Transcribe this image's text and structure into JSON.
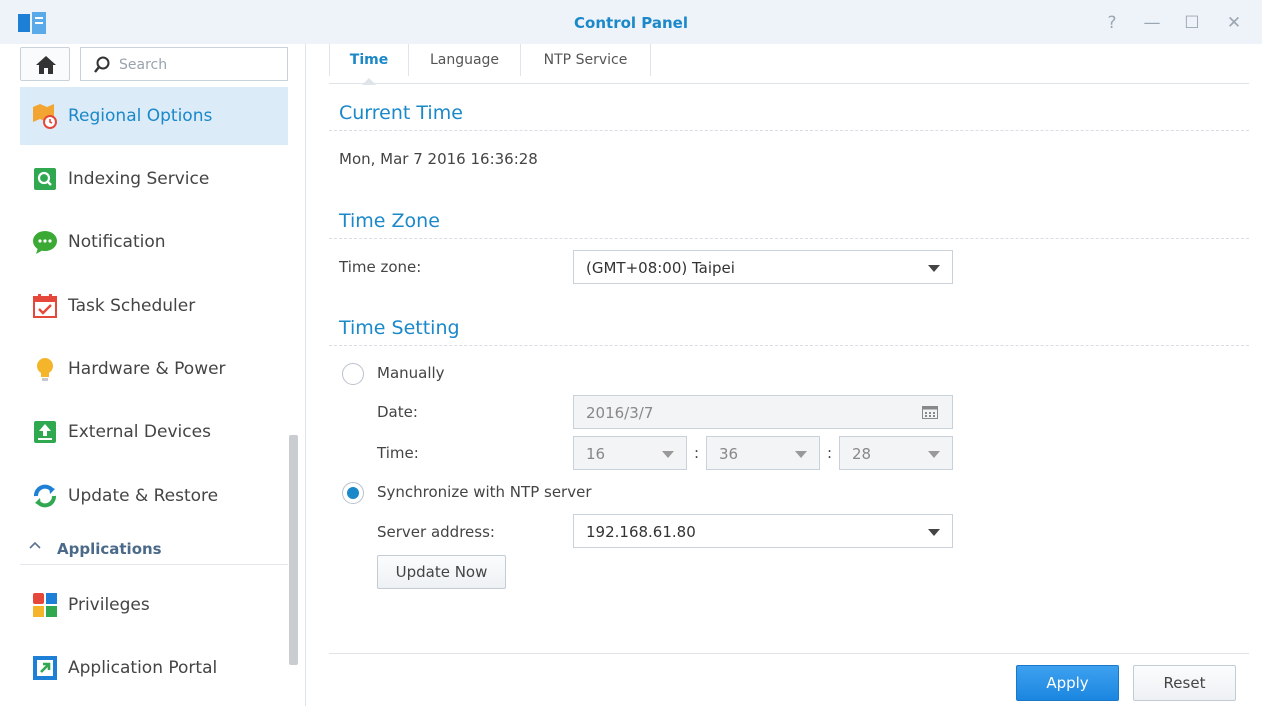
{
  "window": {
    "title": "Control Panel",
    "controls": {
      "help": "?",
      "minimize": "—",
      "maximize": "☐",
      "close": "✕"
    }
  },
  "sidebar": {
    "search_placeholder": "Search",
    "items": [
      {
        "label": "Regional Options",
        "icon": "regional-options-icon",
        "active": true
      },
      {
        "label": "Indexing Service",
        "icon": "indexing-service-icon"
      },
      {
        "label": "Notification",
        "icon": "notification-icon"
      },
      {
        "label": "Task Scheduler",
        "icon": "task-scheduler-icon"
      },
      {
        "label": "Hardware & Power",
        "icon": "hardware-power-icon"
      },
      {
        "label": "External Devices",
        "icon": "external-devices-icon"
      },
      {
        "label": "Update & Restore",
        "icon": "update-restore-icon"
      }
    ],
    "section": {
      "chevron": "^",
      "label": "Applications"
    },
    "app_items": [
      {
        "label": "Privileges",
        "icon": "privileges-icon"
      },
      {
        "label": "Application Portal",
        "icon": "application-portal-icon"
      }
    ]
  },
  "tabs": [
    {
      "label": "Time",
      "active": true
    },
    {
      "label": "Language"
    },
    {
      "label": "NTP Service"
    }
  ],
  "current_time": {
    "heading": "Current Time",
    "value": "Mon, Mar 7 2016 16:36:28"
  },
  "time_zone": {
    "heading": "Time Zone",
    "label": "Time zone:",
    "value": "(GMT+08:00) Taipei"
  },
  "time_setting": {
    "heading": "Time Setting",
    "manual_label": "Manually",
    "date_label": "Date:",
    "date_value": "2016/3/7",
    "time_label": "Time:",
    "hour": "16",
    "minute": "36",
    "second": "28",
    "sep": ":",
    "ntp_label": "Synchronize with NTP server",
    "ntp_selected": true,
    "server_label": "Server address:",
    "server_value": "192.168.61.80",
    "update_now_label": "Update Now"
  },
  "footer": {
    "apply_label": "Apply",
    "reset_label": "Reset"
  },
  "colors": {
    "accent": "#1a88c9",
    "primary_button": "#2b93e8",
    "active_bg": "#dcebf8"
  }
}
